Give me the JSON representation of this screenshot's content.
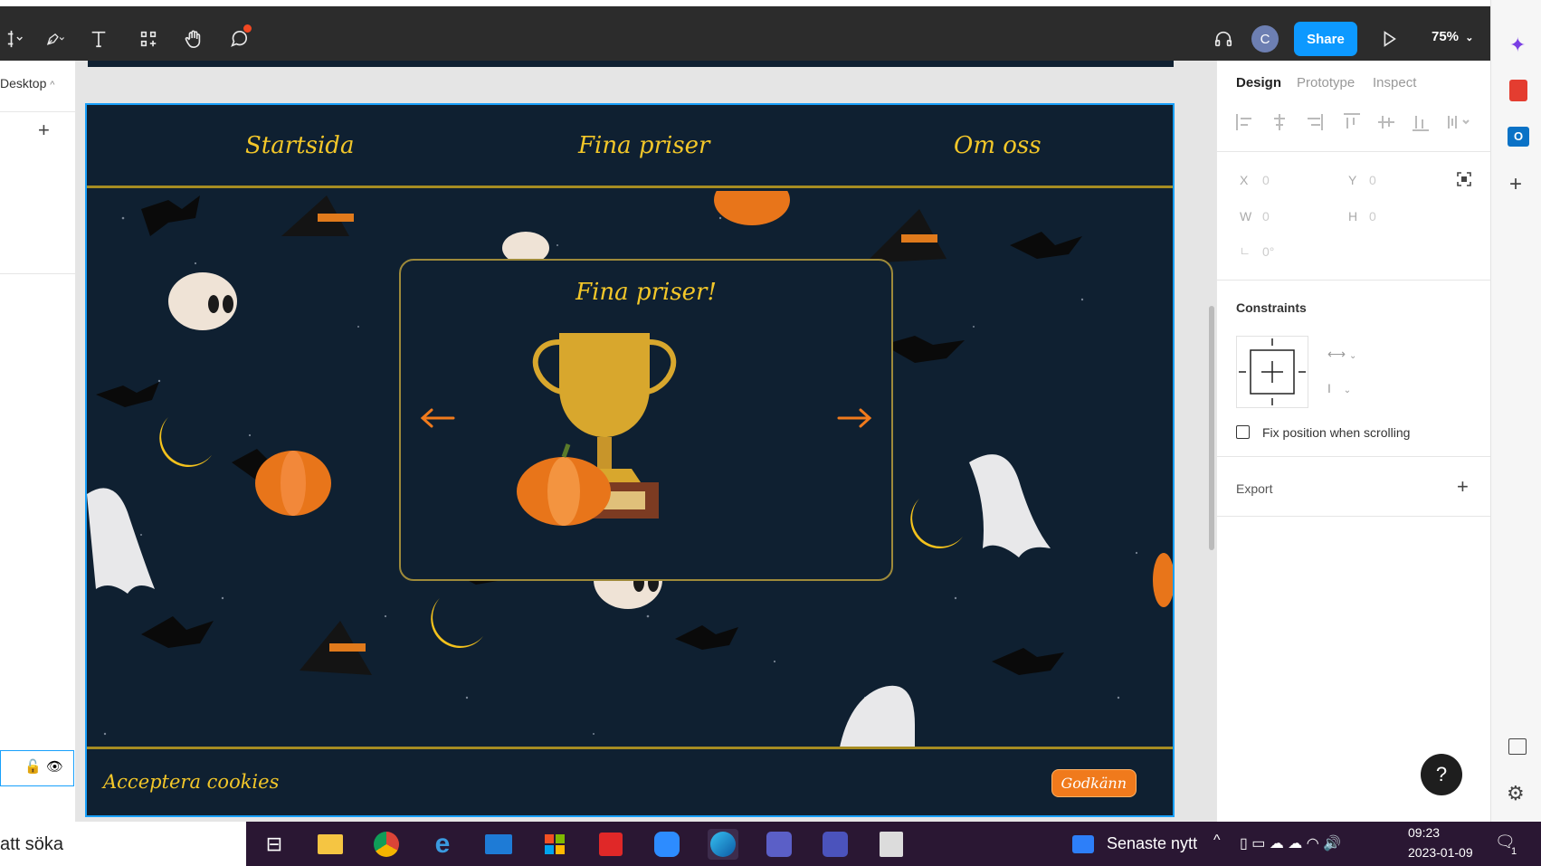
{
  "toolbar": {
    "share_label": "Share",
    "avatar_letter": "C",
    "zoom": "75%"
  },
  "left_panel": {
    "page_label": "Desktop"
  },
  "site": {
    "nav": [
      "Startsida",
      "Fina priser",
      "Om oss"
    ],
    "card_title": "Fina priser!",
    "cookie_text": "Acceptera cookies",
    "accept_label": "Godkänn"
  },
  "right_panel": {
    "tabs": [
      "Design",
      "Prototype",
      "Inspect"
    ],
    "x_label": "X",
    "x_value": "0",
    "y_label": "Y",
    "y_value": "0",
    "w_label": "W",
    "w_value": "0",
    "h_label": "H",
    "h_value": "0",
    "rotation_value": "0°",
    "constraints_title": "Constraints",
    "fix_position_label": "Fix position when scrolling",
    "export_title": "Export"
  },
  "help_label": "?",
  "taskbar": {
    "search_text": "att söka",
    "news_label": "Senaste nytt",
    "time": "09:23",
    "date": "2023-01-09",
    "notification_count": "1"
  },
  "colors": {
    "site_bg": "#0f2031",
    "accent_gold": "#f3c729",
    "accent_orange": "#f07a1c",
    "figma_blue": "#0d99ff"
  }
}
